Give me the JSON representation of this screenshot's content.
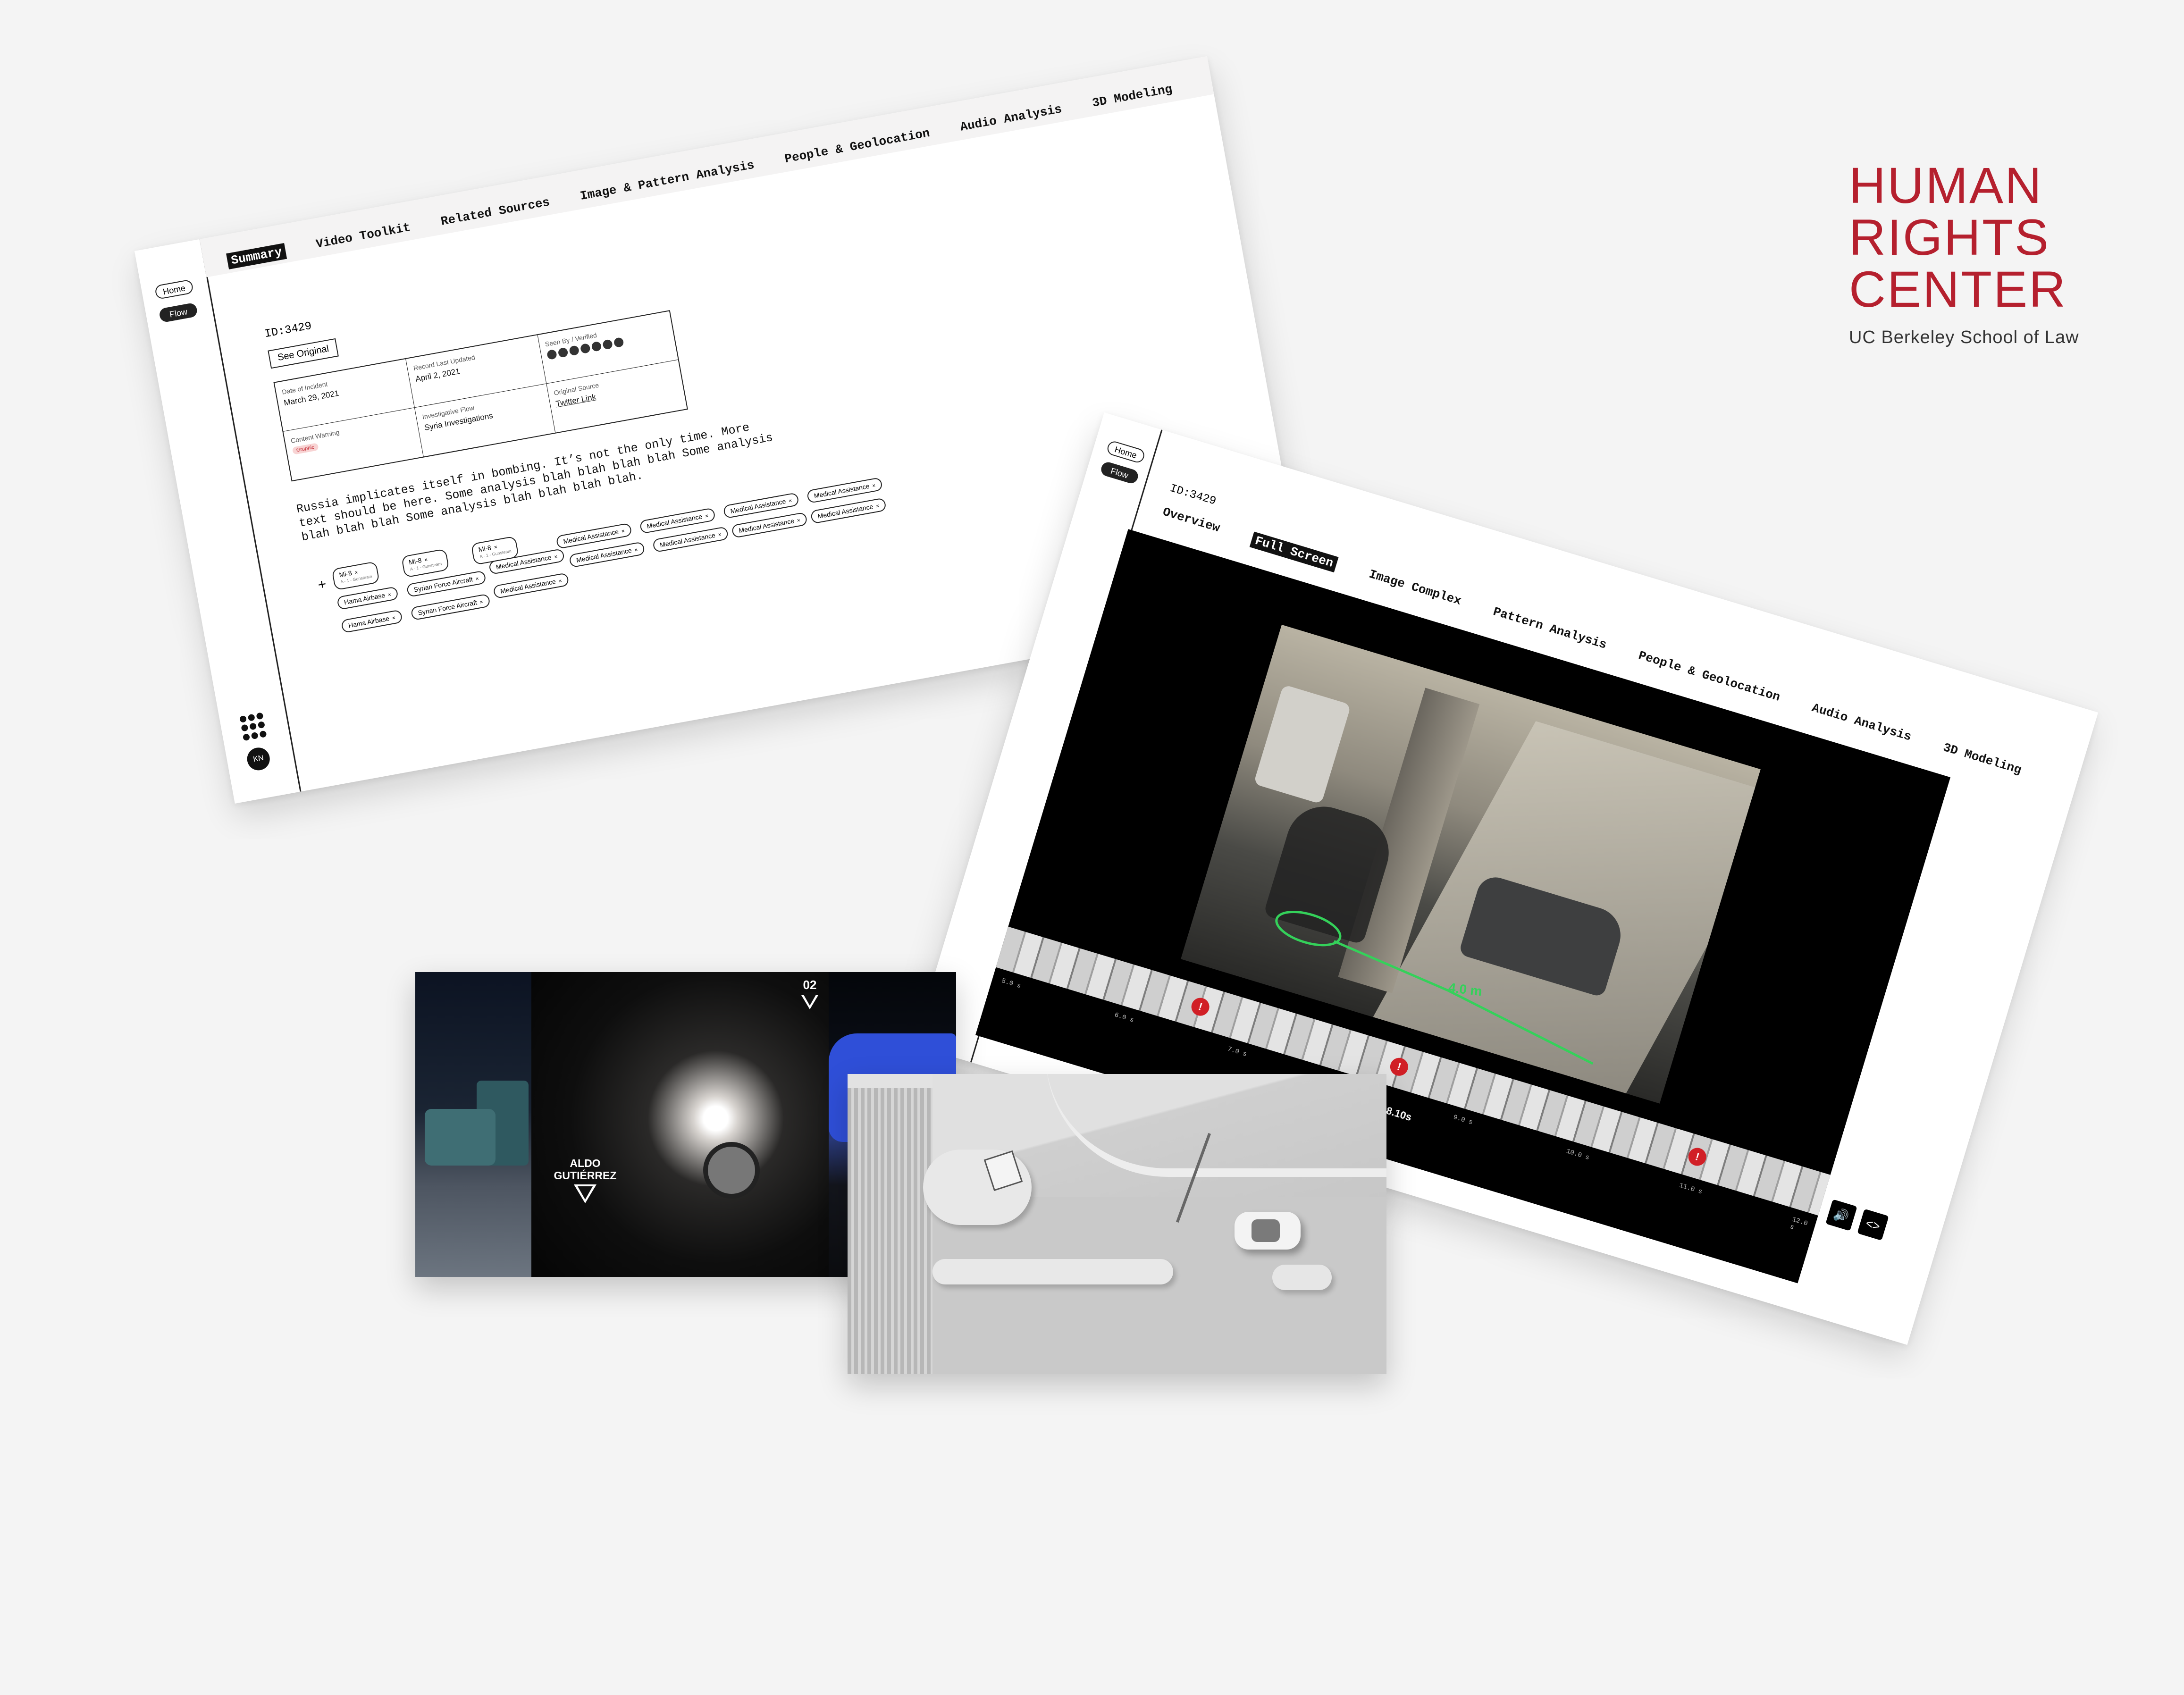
{
  "logo": {
    "line1": "HUMAN",
    "line2": "RIGHTS",
    "line3": "CENTER",
    "subtitle": "UC Berkeley School of Law",
    "color": "#b5202e"
  },
  "summary_window": {
    "nav": {
      "home": "Home",
      "flow": "Flow"
    },
    "tabs": [
      "Summary",
      "Video Toolkit",
      "Related Sources",
      "Image & Pattern Analysis",
      "People & Geolocation",
      "Audio Analysis",
      "3D Modeling"
    ],
    "active_tab": "Summary",
    "record_id": "ID:3429",
    "see_original": "See Original",
    "meta": {
      "date_label": "Date of Incident",
      "date_value": "March 29, 2021",
      "updated_label": "Record Last Updated",
      "updated_value": "April 2, 2021",
      "seen_label": "Seen By / Verified",
      "warning_label": "Content Warning",
      "warning_value": "Graphic",
      "flow_label": "Investigative Flow",
      "flow_value": "Syria Investigations",
      "source_label": "Original Source",
      "source_value": "Twitter Link"
    },
    "summary_text": "Russia implicates itself in bombing. It’s not the only time. More text should be here. Some analysis blah blah blah blah Some analysis blah blah blah Some analysis blah blah blah blah.",
    "add_tag": "+",
    "tags": [
      {
        "label": "Mi-8",
        "sub": "A - 1 - Gunsteam"
      },
      {
        "label": "Mi-8",
        "sub": "A - 1 - Gunsteam"
      },
      {
        "label": "Mi-8",
        "sub": "A - 1 - Gunsteam"
      },
      {
        "label": "Medical Assistance"
      },
      {
        "label": "Medical Assistance"
      },
      {
        "label": "Medical Assistance"
      },
      {
        "label": "Medical Assistance"
      },
      {
        "label": "Hama Airbase"
      },
      {
        "label": "Syrian Force Aircraft"
      },
      {
        "label": "Medical Assistance"
      },
      {
        "label": "Medical Assistance"
      },
      {
        "label": "Medical Assistance"
      },
      {
        "label": "Medical Assistance"
      },
      {
        "label": "Medical Assistance"
      },
      {
        "label": "Hama Airbase"
      },
      {
        "label": "Syrian Force Aircraft"
      },
      {
        "label": "Medical Assistance"
      }
    ],
    "user_initials": "KN"
  },
  "video_window": {
    "nav": {
      "home": "Home",
      "flow": "Flow"
    },
    "record_id": "ID:3429",
    "tabs": [
      "Overview",
      "Full Screen",
      "Image Complex",
      "Pattern Analysis",
      "People & Geolocation",
      "Audio Analysis",
      "3D Modeling"
    ],
    "active_tab": "Full Screen",
    "measurement": "4.0 m",
    "time_ticks": [
      "5.0 s",
      "6.0 s",
      "7.0 s",
      "8.0 s",
      "9.0 s",
      "10.0 s",
      "11.0 s",
      "12.0 s"
    ],
    "cursor_time": "8.10s",
    "marker_symbol": "!",
    "controls": {
      "audio_icon": "speaker-icon",
      "code_icon": "code-icon"
    },
    "accent": "#d11f26"
  },
  "night_scene": {
    "person_name": "ALDO\nGUTIÉRREZ",
    "camera_number": "02"
  },
  "model_scene": {
    "description_icon": "3d-model"
  }
}
